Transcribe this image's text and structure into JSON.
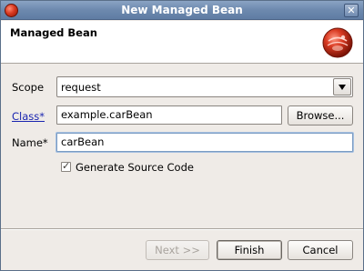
{
  "window": {
    "title": "New Managed Bean",
    "close_glyph": "✕",
    "app_icon": "eclipse-icon"
  },
  "banner": {
    "title": "Managed Bean",
    "icon": "bean-wizard-icon"
  },
  "form": {
    "scope": {
      "label": "Scope",
      "value": "request"
    },
    "class": {
      "label": "Class*",
      "value": "example.carBean",
      "browse_label": "Browse..."
    },
    "name": {
      "label": "Name*",
      "value": "carBean"
    },
    "generate": {
      "label": "Generate Source Code",
      "checked": true
    }
  },
  "buttons": {
    "next": "Next >>",
    "finish": "Finish",
    "cancel": "Cancel"
  },
  "colors": {
    "titlebar": "#6d89ae",
    "link": "#1a25b0",
    "focus": "#7b9cc3",
    "icon_red": "#d83a22"
  }
}
